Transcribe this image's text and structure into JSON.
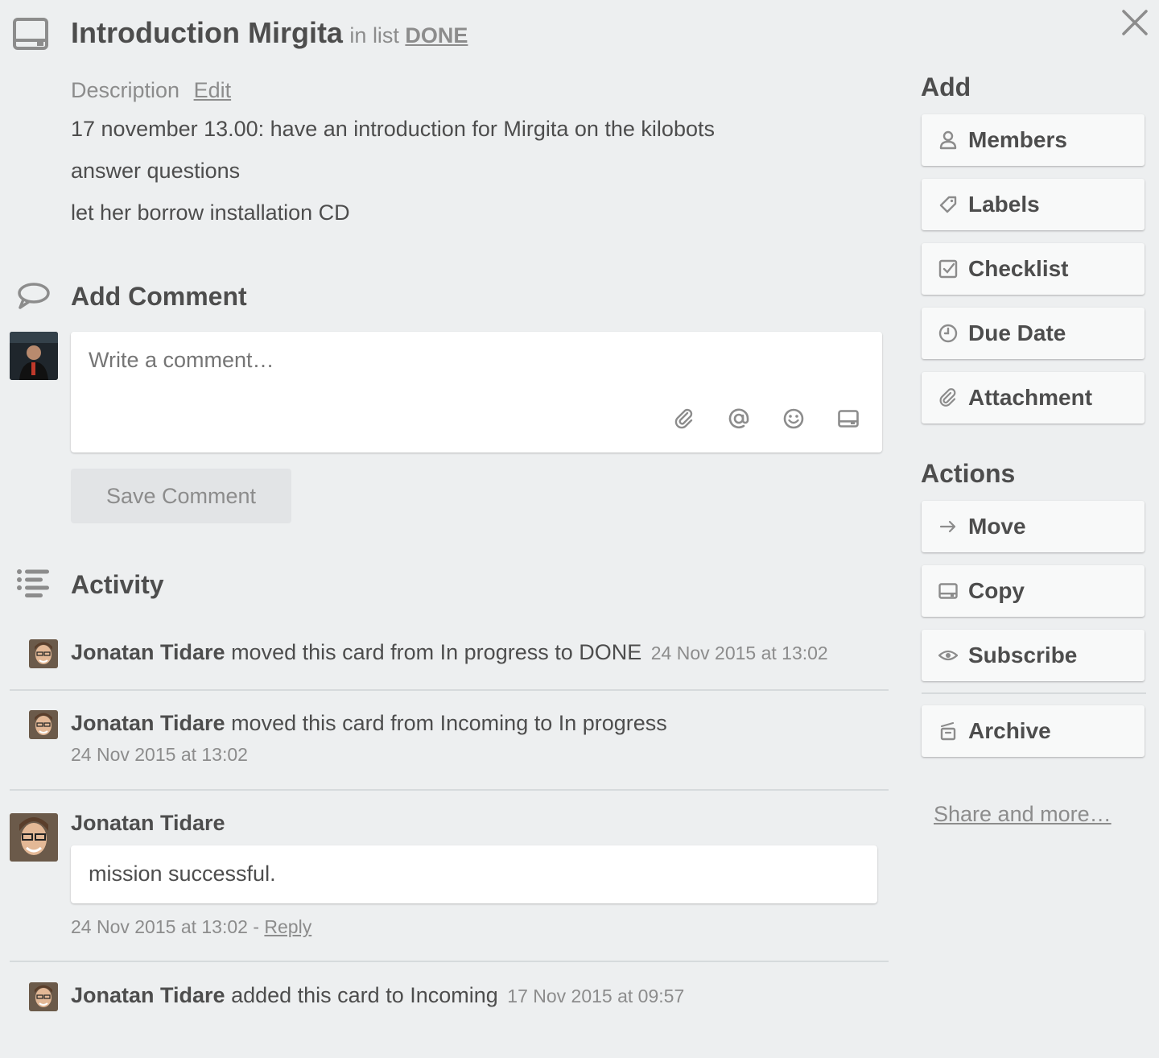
{
  "card": {
    "title": "Introduction Mirgita",
    "in_list_prefix": "in list",
    "list_name": "DONE"
  },
  "description": {
    "label": "Description",
    "edit_label": "Edit",
    "lines": [
      "17 november 13.00: have an introduction for Mirgita on the kilobots",
      "answer questions",
      "let her borrow installation CD"
    ]
  },
  "add_comment": {
    "title": "Add Comment",
    "placeholder": "Write a comment…",
    "save_label": "Save Comment"
  },
  "activity": {
    "title": "Activity",
    "entries": [
      {
        "user": "Jonatan Tidare",
        "action": " moved this card from In progress to DONE",
        "time": "24 Nov 2015 at 13:02"
      },
      {
        "user": "Jonatan Tidare",
        "action": " moved this card from Incoming to In progress",
        "time": "24 Nov 2015 at 13:02"
      },
      {
        "user": "Jonatan Tidare",
        "comment": "mission successful.",
        "time": "24 Nov 2015 at 13:02",
        "separator": " - ",
        "reply_label": "Reply"
      },
      {
        "user": "Jonatan Tidare",
        "action": " added this card to Incoming",
        "time": "17 Nov 2015 at 09:57"
      }
    ]
  },
  "sidebar": {
    "add_title": "Add",
    "add_buttons": [
      {
        "label": "Members",
        "icon": "person-icon"
      },
      {
        "label": "Labels",
        "icon": "tag-icon"
      },
      {
        "label": "Checklist",
        "icon": "checkbox-icon"
      },
      {
        "label": "Due Date",
        "icon": "clock-icon"
      },
      {
        "label": "Attachment",
        "icon": "paperclip-icon"
      }
    ],
    "actions_title": "Actions",
    "action_buttons": [
      {
        "label": "Move",
        "icon": "arrow-right-icon"
      },
      {
        "label": "Copy",
        "icon": "card-icon"
      },
      {
        "label": "Subscribe",
        "icon": "eye-icon"
      }
    ],
    "archive_label": "Archive",
    "share_label": "Share and more…"
  },
  "colors": {
    "background": "#edeff0",
    "text": "#4d4d4d",
    "muted": "#8c8c8c",
    "button_bg": "#f8f9f9"
  }
}
